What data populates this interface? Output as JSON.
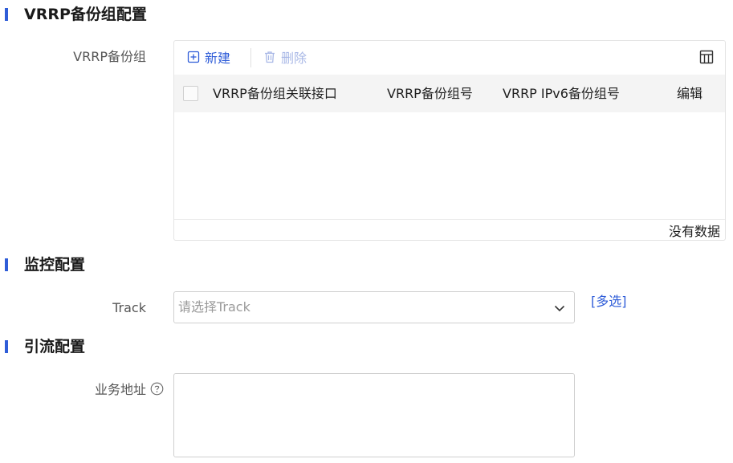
{
  "sections": {
    "vrrp": "VRRP备份组配置",
    "monitor": "监控配置",
    "traffic": "引流配置"
  },
  "vrrp_group": {
    "label": "VRRP备份组",
    "toolbar": {
      "new_label": "新建",
      "delete_label": "删除"
    },
    "columns": [
      "VRRP备份组关联接口",
      "VRRP备份组号",
      "VRRP IPv6备份组号",
      "编辑"
    ],
    "rows": [],
    "empty_text": "没有数据"
  },
  "track": {
    "label": "Track",
    "placeholder": "请选择Track",
    "multi_link": "[多选]"
  },
  "service_address": {
    "label": "业务地址",
    "value": ""
  },
  "colors": {
    "accent": "#2f5dd8",
    "disabled": "#a9b8e6"
  }
}
